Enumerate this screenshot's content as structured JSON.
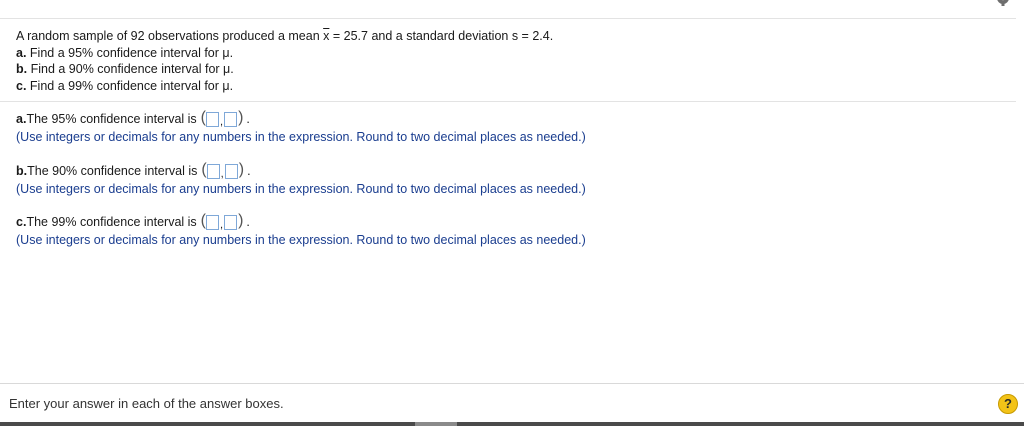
{
  "question": {
    "intro_prefix": "A random sample of 92 observations produced a mean ",
    "xbar_symbol": "x",
    "intro_suffix": " = 25.7 and a standard deviation s = 2.4.",
    "items": [
      {
        "letter": "a.",
        "text": " Find a 95% confidence interval for μ."
      },
      {
        "letter": "b.",
        "text": " Find a 90% confidence interval for μ."
      },
      {
        "letter": "c.",
        "text": " Find a 99% confidence interval for μ."
      }
    ]
  },
  "parts": [
    {
      "letter": "a.",
      "prompt": " The 95% confidence interval is",
      "open_paren": "(",
      "separator": ",",
      "close_paren": ")",
      "period": ".",
      "hint": "(Use integers or decimals for any numbers in the expression. Round to two decimal places as needed.)"
    },
    {
      "letter": "b.",
      "prompt": " The 90% confidence interval is",
      "open_paren": "(",
      "separator": ",",
      "close_paren": ")",
      "period": ".",
      "hint": "(Use integers or decimals for any numbers in the expression. Round to two decimal places as needed.)"
    },
    {
      "letter": "c.",
      "prompt": " The 99% confidence interval is",
      "open_paren": "(",
      "separator": ",",
      "close_paren": ")",
      "period": ".",
      "hint": "(Use integers or decimals for any numbers in the expression. Round to two decimal places as needed.)"
    }
  ],
  "footer": {
    "instruction": "Enter your answer in each of the answer boxes.",
    "help_label": "?"
  },
  "icons": {
    "settings": "gear-icon",
    "help": "help-icon"
  },
  "colors": {
    "hint_text": "#1a3d8f",
    "answer_box_border": "#7fa8d8",
    "help_button": "#f3c318"
  }
}
